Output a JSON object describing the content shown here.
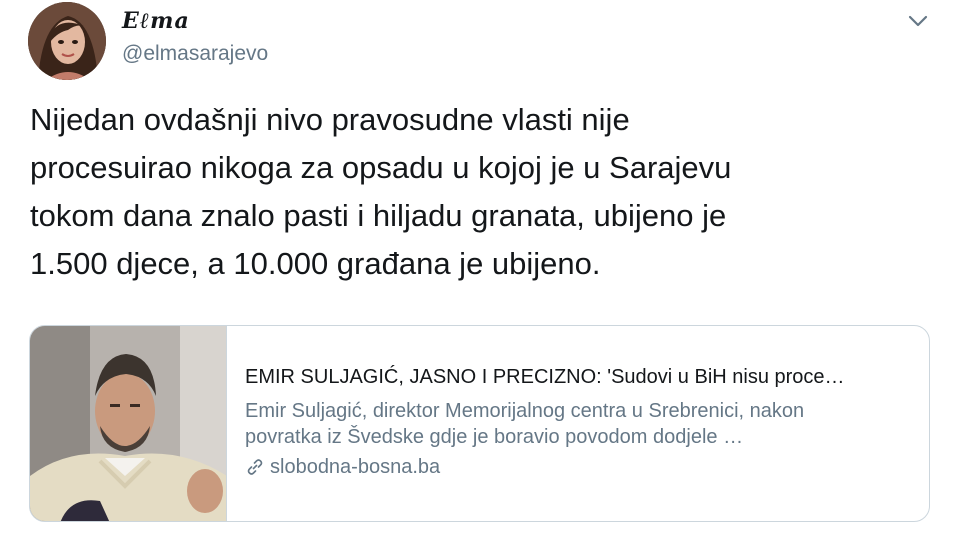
{
  "tweet": {
    "display_name": "Eℓma",
    "handle": "@elmasarajevo",
    "text": "Nijedan ovdašnji nivo pravosudne vlasti nije\nprocesuirao nikoga za opsadu u kojoj je u Sarajevu\ntokom dana znalo pasti i hiljadu granata, ubijeno je\n1.500 djece, a 10.000 građana je ubijeno."
  },
  "card": {
    "title": "EMIR SULJAGIĆ, JASNO I PRECIZNO: 'Sudovi u BiH nisu proce…",
    "description_line1": "Emir Suljagić, direktor Memorijalnog centra u Srebrenici, nakon",
    "description_line2": "povratka iz Švedske gdje je boravio povodom dodjele …",
    "domain": "slobodna-bosna.ba"
  },
  "icons": {
    "menu": "chevron-down-icon",
    "link": "link-icon"
  },
  "colors": {
    "text": "#14171a",
    "secondary_text": "#657786",
    "border": "#ccd6dd"
  }
}
